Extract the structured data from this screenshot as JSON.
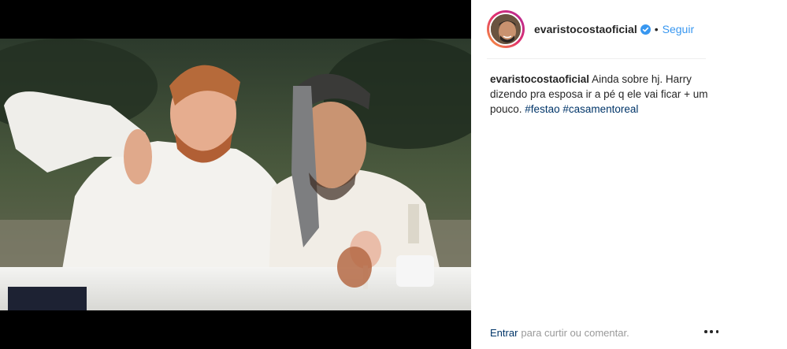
{
  "post": {
    "username": "evaristocostaoficial",
    "separator": "•",
    "follow_label": "Seguir",
    "caption_user": "evaristocostaoficial",
    "caption_text": " Ainda sobre hj. Harry dizendo pra esposa ir a pé q ele vai ficar + um pouco. ",
    "hashtags": [
      "#festao",
      "#casamentoreal"
    ]
  },
  "footer": {
    "login_label": "Entrar",
    "login_rest": "para curtir ou comentar."
  },
  "icons": {
    "verified": "verified-badge-icon",
    "more": "more-options-icon"
  },
  "colors": {
    "link_blue": "#3897f0",
    "hashtag_blue": "#003569",
    "text": "#262626",
    "muted": "#999999"
  }
}
